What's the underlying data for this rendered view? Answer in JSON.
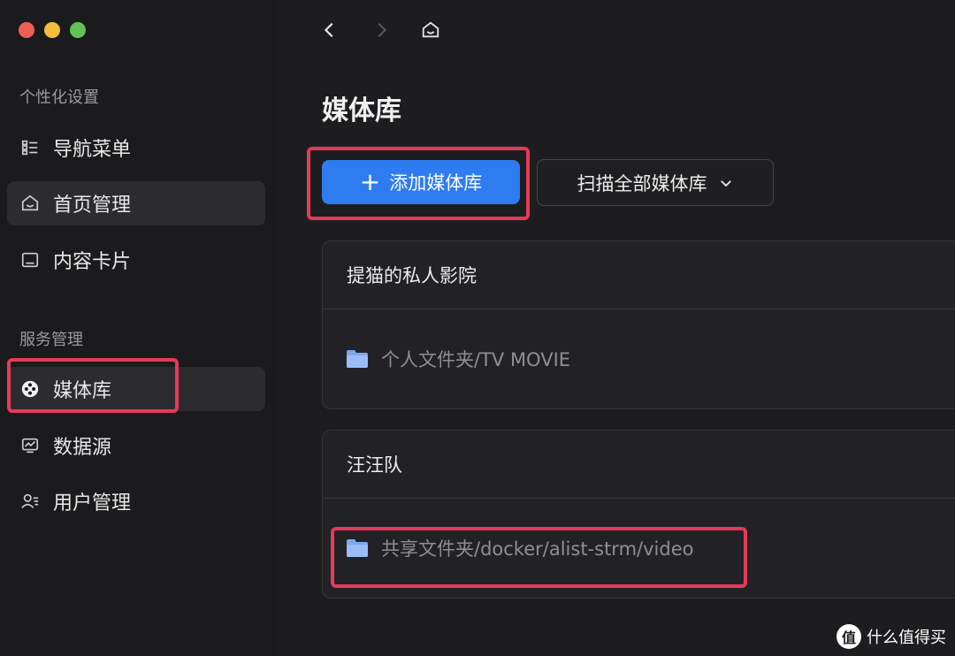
{
  "sidebar": {
    "sections": [
      {
        "title": "个性化设置"
      },
      {
        "title": "服务管理"
      }
    ],
    "items": [
      {
        "label": "导航菜单",
        "icon": "list-icon"
      },
      {
        "label": "首页管理",
        "icon": "home-icon"
      },
      {
        "label": "内容卡片",
        "icon": "card-icon"
      },
      {
        "label": "媒体库",
        "icon": "film-reel-icon"
      },
      {
        "label": "数据源",
        "icon": "monitor-chart-icon"
      },
      {
        "label": "用户管理",
        "icon": "users-icon"
      }
    ]
  },
  "main": {
    "title": "媒体库",
    "add_button": {
      "label": "添加媒体库",
      "icon": "plus-icon"
    },
    "scan_button": {
      "label": "扫描全部媒体库",
      "icon": "chevron-down-icon"
    },
    "libraries": [
      {
        "name": "提猫的私人影院",
        "path": "个人文件夹/TV MOVIE"
      },
      {
        "name": "汪汪队",
        "path": "共享文件夹/docker/alist-strm/video"
      }
    ]
  },
  "watermark": {
    "text": "什么值得买",
    "logo": "值"
  },
  "colors": {
    "accent": "#2f7cf0",
    "highlight": "#e6395a",
    "folder": "#7ea7f2"
  }
}
